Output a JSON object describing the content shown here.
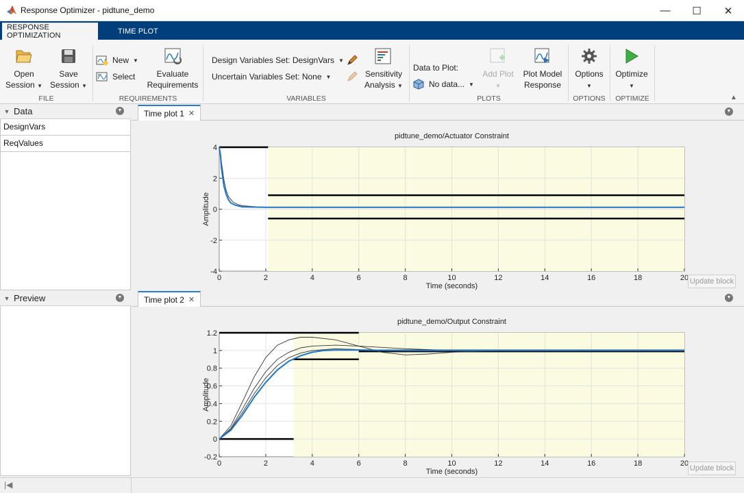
{
  "window": {
    "title": "Response Optimizer - pidtune_demo",
    "minimize": "—",
    "maximize": "☐",
    "close": "✕"
  },
  "ribbon_tabs": [
    "RESPONSE OPTIMIZATION",
    "TIME PLOT"
  ],
  "file_group": {
    "label": "FILE",
    "open_line1": "Open",
    "open_line2": "Session",
    "save_line1": "Save",
    "save_line2": "Session"
  },
  "requirements_group": {
    "label": "REQUIREMENTS",
    "new": "New",
    "select": "Select",
    "evaluate_line1": "Evaluate",
    "evaluate_line2": "Requirements"
  },
  "variables_group": {
    "label": "VARIABLES",
    "design_set": "Design Variables Set: DesignVars",
    "uncertain_set": "Uncertain Variables Set: None",
    "sensitivity_line1": "Sensitivity",
    "sensitivity_line2": "Analysis"
  },
  "plots_group": {
    "label": "PLOTS",
    "data_to_plot": "Data to Plot:",
    "data_select": "No data...",
    "add_plot": "Add Plot",
    "plot_model_line1": "Plot Model",
    "plot_model_line2": "Response"
  },
  "options_group": {
    "label": "OPTIONS",
    "options": "Options"
  },
  "optimize_group": {
    "label": "OPTIMIZE",
    "optimize": "Optimize"
  },
  "data_panel": {
    "title": "Data",
    "items": [
      "DesignVars",
      "ReqValues"
    ]
  },
  "preview_panel": {
    "title": "Preview"
  },
  "plot1_tab": "Time plot 1",
  "plot2_tab": "Time plot 2",
  "update_block": "Update block",
  "colors": {
    "ribbon_blue": "#003f7c",
    "response_line": "#1f77c8",
    "feasible_region": "#fbfbe1",
    "tab_accent": "#2a7bd4"
  },
  "chart_data": [
    {
      "type": "line",
      "title": "pidtune_demo/Actuator  Constraint",
      "xlabel": "Time (seconds)",
      "ylabel": "Amplitude",
      "xlim": [
        0,
        20
      ],
      "ylim": [
        -4,
        4
      ],
      "xticks": [
        0,
        2,
        4,
        6,
        8,
        10,
        12,
        14,
        16,
        18,
        20
      ],
      "yticks": [
        -4,
        -2,
        0,
        2,
        4
      ],
      "grid": true,
      "constraint_bounds": [
        {
          "name": "upper",
          "segments": [
            [
              [
                0,
                4
              ],
              [
                2.1,
                4
              ]
            ],
            [
              [
                2.1,
                0.9
              ],
              [
                20,
                0.9
              ]
            ]
          ]
        },
        {
          "name": "lower",
          "segments": [
            [
              [
                2.1,
                -0.6
              ],
              [
                20,
                -0.6
              ]
            ]
          ]
        }
      ],
      "series": [
        {
          "role": "optimized",
          "x": [
            0,
            0.05,
            0.1,
            0.2,
            0.3,
            0.4,
            0.5,
            0.7,
            1.0,
            2,
            20
          ],
          "y": [
            4.0,
            3.5,
            2.6,
            1.5,
            0.95,
            0.6,
            0.4,
            0.25,
            0.15,
            0.12,
            0.12
          ]
        },
        {
          "role": "iteration",
          "x": [
            0,
            0.05,
            0.1,
            0.2,
            0.3,
            0.4,
            0.6,
            0.8,
            1.0,
            1.6,
            2,
            20
          ],
          "y": [
            4.0,
            3.7,
            3.0,
            1.9,
            1.2,
            0.8,
            0.45,
            0.3,
            0.22,
            0.15,
            0.12,
            0.12
          ]
        }
      ]
    },
    {
      "type": "line",
      "title": "pidtune_demo/Output  Constraint",
      "xlabel": "Time (seconds)",
      "ylabel": "Amplitude",
      "xlim": [
        0,
        20
      ],
      "ylim": [
        -0.2,
        1.2
      ],
      "xticks": [
        0,
        2,
        4,
        6,
        8,
        10,
        12,
        14,
        16,
        18,
        20
      ],
      "yticks": [
        -0.2,
        0,
        0.2,
        0.4,
        0.6,
        0.8,
        1,
        1.2
      ],
      "grid": true,
      "constraint_bounds": [
        {
          "name": "upper",
          "segments": [
            [
              [
                0,
                1.2
              ],
              [
                6,
                1.2
              ]
            ],
            [
              [
                6,
                1.0
              ],
              [
                20,
                1.0
              ]
            ]
          ]
        },
        {
          "name": "lower",
          "segments": [
            [
              [
                0,
                0
              ],
              [
                3.2,
                0
              ]
            ],
            [
              [
                3.2,
                0.9
              ],
              [
                6,
                0.9
              ]
            ],
            [
              [
                6,
                0.99
              ],
              [
                20,
                0.99
              ]
            ]
          ]
        }
      ],
      "series": [
        {
          "role": "optimized",
          "x": [
            0,
            0.5,
            1,
            1.5,
            2,
            2.5,
            3,
            3.5,
            4,
            4.5,
            5,
            6,
            8,
            10,
            20
          ],
          "y": [
            0,
            0.1,
            0.27,
            0.47,
            0.64,
            0.78,
            0.88,
            0.94,
            0.98,
            1.0,
            1.005,
            1.005,
            1.0,
            1.0,
            1.0
          ]
        },
        {
          "role": "iteration",
          "x": [
            0,
            0.5,
            1,
            1.5,
            2,
            2.5,
            3,
            3.5,
            4,
            5,
            6,
            7,
            8,
            9,
            10,
            12,
            20
          ],
          "y": [
            0,
            0.15,
            0.42,
            0.7,
            0.92,
            1.06,
            1.12,
            1.15,
            1.15,
            1.12,
            1.05,
            0.98,
            0.95,
            0.96,
            0.98,
            1.0,
            1.0
          ]
        },
        {
          "role": "iteration",
          "x": [
            0,
            0.5,
            1,
            1.5,
            2,
            2.5,
            3,
            3.5,
            4,
            5,
            6,
            8,
            10,
            20
          ],
          "y": [
            0,
            0.12,
            0.34,
            0.57,
            0.76,
            0.9,
            0.98,
            1.03,
            1.05,
            1.06,
            1.05,
            1.02,
            1.0,
            1.0
          ]
        },
        {
          "role": "iteration",
          "x": [
            0,
            0.5,
            1,
            1.5,
            2,
            2.5,
            3,
            3.5,
            4,
            5,
            6,
            8,
            20
          ],
          "y": [
            0,
            0.11,
            0.3,
            0.51,
            0.69,
            0.83,
            0.92,
            0.97,
            1.0,
            1.02,
            1.01,
            1.0,
            1.0
          ]
        }
      ]
    }
  ]
}
